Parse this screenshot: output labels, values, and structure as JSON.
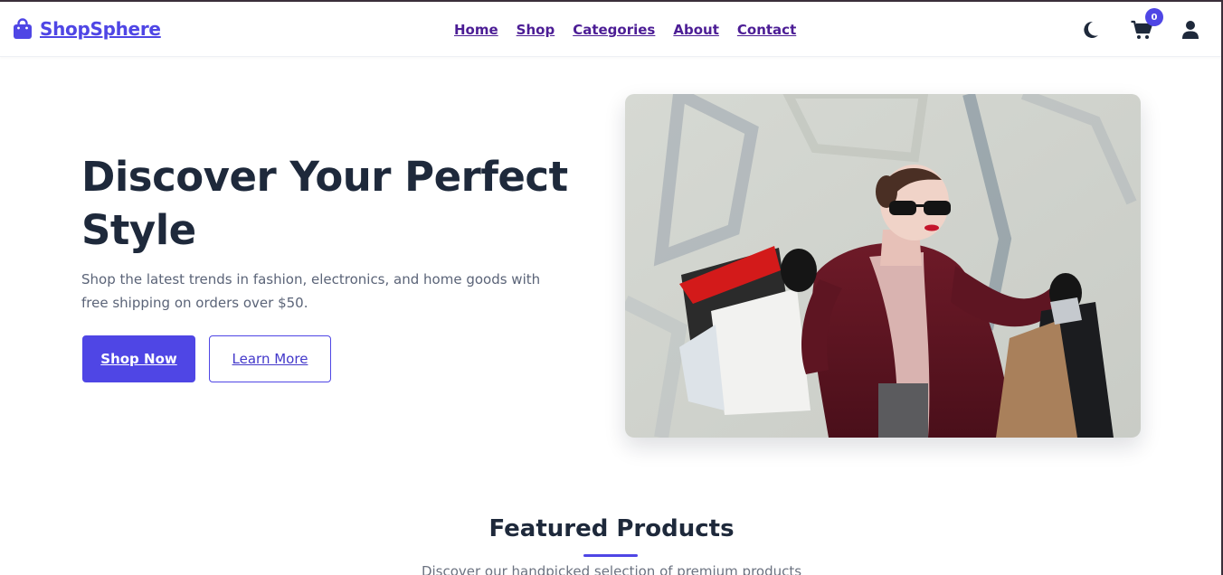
{
  "brand": {
    "name": "ShopSphere",
    "icon": "shopping-bag-icon",
    "color": "#4f46e5"
  },
  "nav": {
    "links": [
      "Home",
      "Shop",
      "Categories",
      "About",
      "Contact"
    ],
    "theme_icon": "moon-icon",
    "cart_icon": "cart-icon",
    "cart_count": "0",
    "user_icon": "user-icon"
  },
  "hero": {
    "title": "Discover Your Perfect Style",
    "subtitle": "Shop the latest trends in fashion, electronics, and home goods with free shipping on orders over $50.",
    "primary_button": "Shop Now",
    "secondary_button": "Learn More",
    "image_alt": "woman-with-shopping-bags"
  },
  "featured": {
    "title": "Featured Products",
    "subtitle": "Discover our handpicked selection of premium products"
  },
  "colors": {
    "accent": "#4f46e5",
    "nav_link": "#4c1d95",
    "heading": "#1e293b",
    "body_text": "#5b6478"
  }
}
